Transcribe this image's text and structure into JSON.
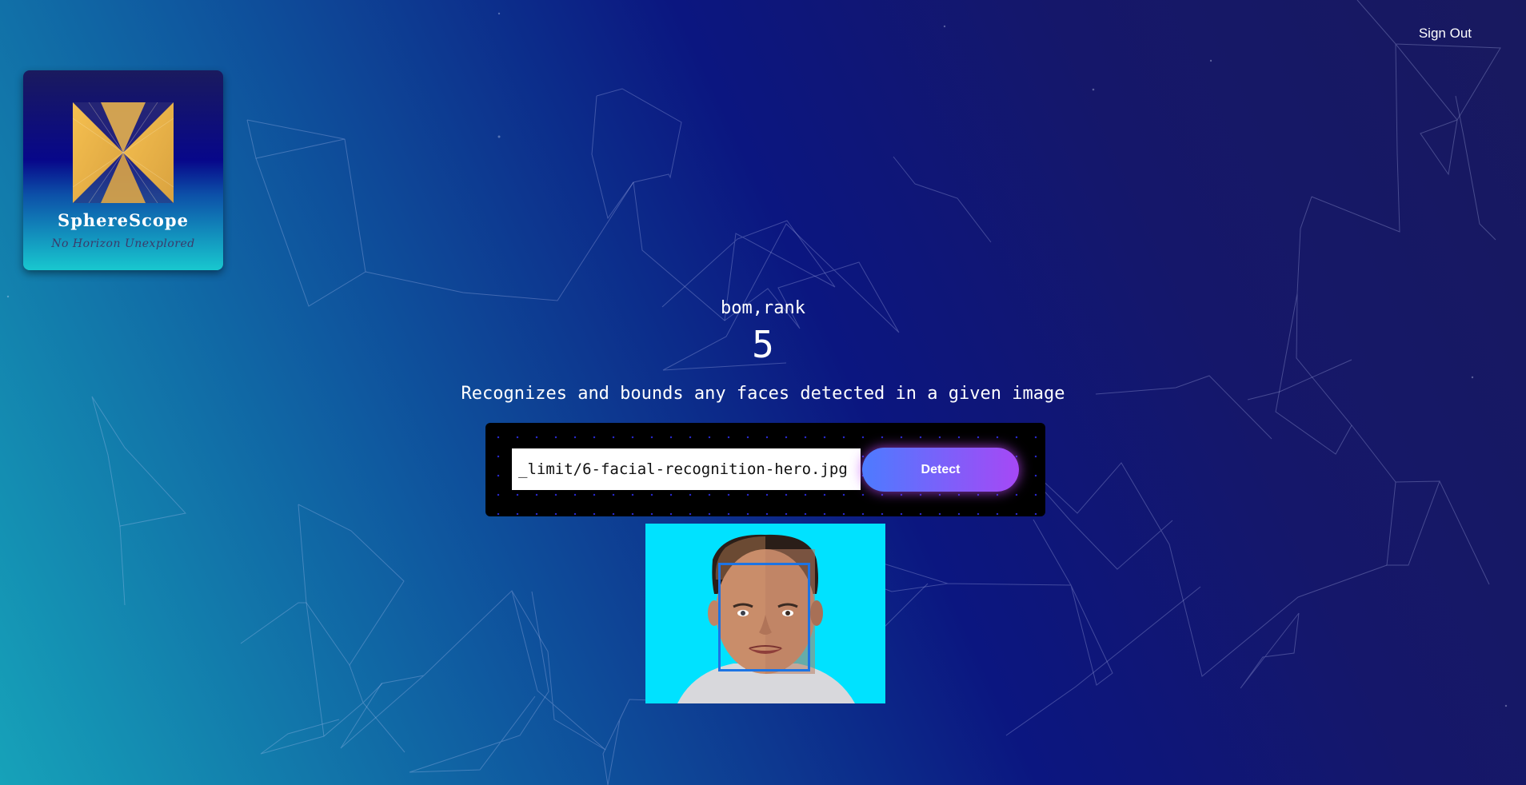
{
  "header": {
    "signout_label": "Sign Out"
  },
  "logo": {
    "title": "SphereScope",
    "tagline": "No Horizon Unexplored"
  },
  "rank": {
    "label": "bom,rank",
    "value": "5"
  },
  "description": "Recognizes and bounds any faces detected in a given image",
  "form": {
    "input_value": "_limit/6-facial-recognition-hero.jpg",
    "button_label": "Detect"
  },
  "colors": {
    "accent_start": "#4d7bff",
    "accent_end": "#a648f5",
    "box": "#1c74e4",
    "image_bg": "#00e2ff"
  }
}
